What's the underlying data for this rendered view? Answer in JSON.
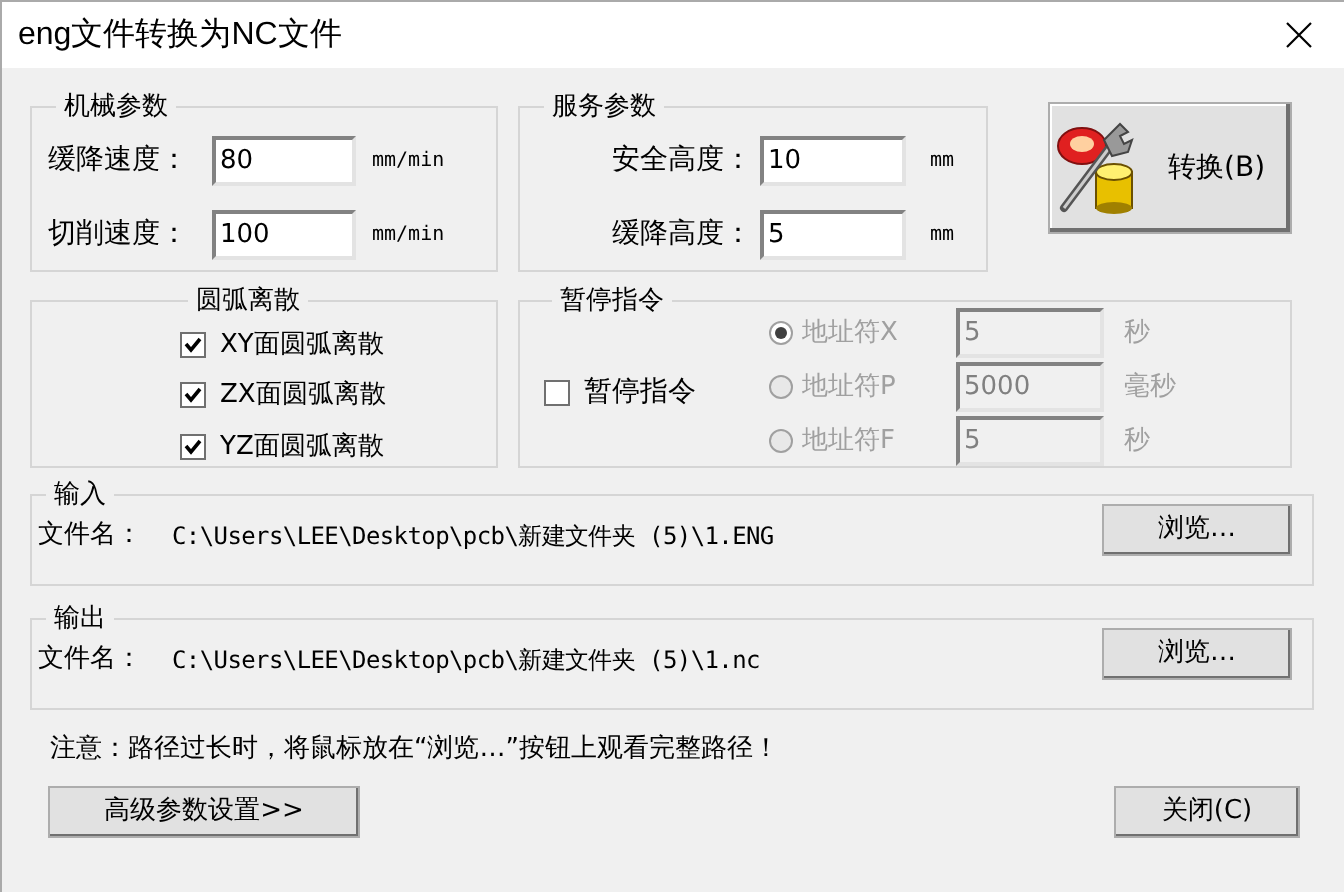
{
  "window": {
    "title": "eng文件转换为NC文件"
  },
  "mechanical": {
    "title": "机械参数",
    "fields": [
      {
        "label": "缓降速度：",
        "value": "80",
        "unit": "mm/min"
      },
      {
        "label": "切削速度：",
        "value": "100",
        "unit": "mm/min"
      }
    ]
  },
  "service": {
    "title": "服务参数",
    "fields": [
      {
        "label": "安全高度：",
        "value": "10",
        "unit": "mm"
      },
      {
        "label": "缓降高度：",
        "value": "5",
        "unit": "mm"
      }
    ]
  },
  "convert_button": {
    "label": "转换(B)"
  },
  "arc": {
    "title": "圆弧离散",
    "options": [
      {
        "label": "XY面圆弧离散",
        "checked": true
      },
      {
        "label": "ZX面圆弧离散",
        "checked": true
      },
      {
        "label": "YZ面圆弧离散",
        "checked": true
      }
    ]
  },
  "pause": {
    "title": "暂停指令",
    "enable": {
      "label": "暂停指令",
      "checked": false
    },
    "options": [
      {
        "label": "地址符X",
        "selected": true,
        "disabled": true,
        "value": "5",
        "unit": "秒"
      },
      {
        "label": "地址符P",
        "selected": false,
        "disabled": true,
        "value": "5000",
        "unit": "毫秒"
      },
      {
        "label": "地址符F",
        "selected": false,
        "disabled": true,
        "value": "5",
        "unit": "秒"
      }
    ]
  },
  "input": {
    "title": "输入",
    "file_label": "文件名：",
    "path": "C:\\Users\\LEE\\Desktop\\pcb\\新建文件夹 (5)\\1.ENG",
    "browse": "浏览…"
  },
  "output": {
    "title": "输出",
    "file_label": "文件名：",
    "path": "C:\\Users\\LEE\\Desktop\\pcb\\新建文件夹 (5)\\1.nc",
    "browse": "浏览…"
  },
  "note": "注意：路径过长时，将鼠标放在“浏览…”按钮上观看完整路径！",
  "buttons": {
    "advanced": "高级参数设置>>",
    "close": "关闭(C)"
  }
}
